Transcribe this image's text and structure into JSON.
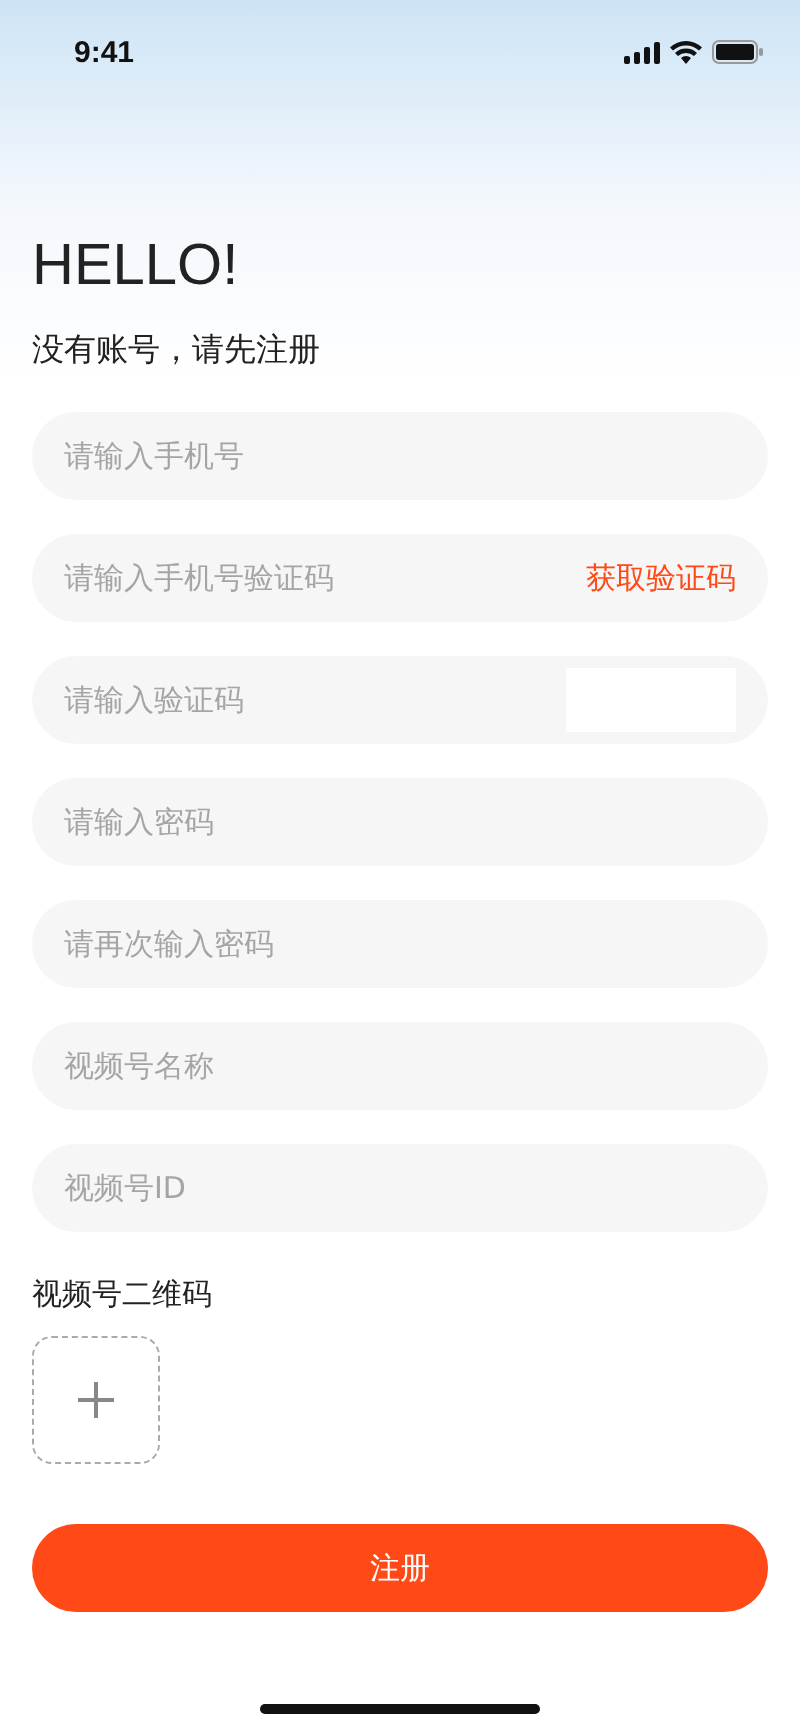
{
  "status_bar": {
    "time": "9:41"
  },
  "title": "HELLO!",
  "subtitle": "没有账号，请先注册",
  "fields": [
    {
      "kind": "input",
      "placeholder": "请输入手机号"
    },
    {
      "kind": "sms",
      "placeholder": "请输入手机号验证码",
      "action": "获取验证码"
    },
    {
      "kind": "captcha",
      "placeholder": "请输入验证码"
    },
    {
      "kind": "input",
      "placeholder": "请输入密码"
    },
    {
      "kind": "input",
      "placeholder": "请再次输入密码"
    },
    {
      "kind": "input",
      "placeholder": "视频号名称"
    },
    {
      "kind": "input",
      "placeholder": "视频号ID"
    }
  ],
  "qr_label": "视频号二维码",
  "submit": "注册"
}
